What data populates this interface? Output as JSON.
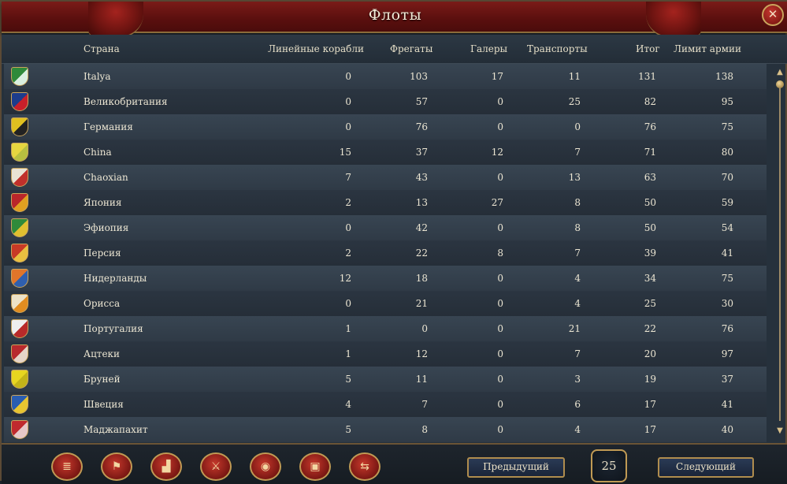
{
  "window": {
    "title": "Флоты",
    "close_icon": "close-icon"
  },
  "table": {
    "columns": [
      "Страна",
      "Линейные корабли",
      "Фрегаты",
      "Галеры",
      "Транспорты",
      "Итог",
      "Лимит армии"
    ],
    "rows": [
      {
        "country": "Italya",
        "flag": [
          "#2f8a3a",
          "#d9efe0"
        ],
        "heavy": "0",
        "frigates": "103",
        "galleys": "17",
        "transports": "11",
        "total": "131",
        "limit": "138"
      },
      {
        "country": "Великобритания",
        "flag": [
          "#1d3c8c",
          "#c8202a"
        ],
        "heavy": "0",
        "frigates": "57",
        "galleys": "0",
        "transports": "25",
        "total": "82",
        "limit": "95"
      },
      {
        "country": "Германия",
        "flag": [
          "#e0c020",
          "#222222"
        ],
        "heavy": "0",
        "frigates": "76",
        "galleys": "0",
        "transports": "0",
        "total": "76",
        "limit": "75"
      },
      {
        "country": "China",
        "flag": [
          "#e6d640",
          "#b8c040"
        ],
        "heavy": "15",
        "frigates": "37",
        "galleys": "12",
        "transports": "7",
        "total": "71",
        "limit": "80"
      },
      {
        "country": "Chaoxian",
        "flag": [
          "#e9e3d4",
          "#c0302b"
        ],
        "heavy": "7",
        "frigates": "43",
        "galleys": "0",
        "transports": "13",
        "total": "63",
        "limit": "70"
      },
      {
        "country": "Япония",
        "flag": [
          "#b9262a",
          "#e0a020"
        ],
        "heavy": "2",
        "frigates": "13",
        "galleys": "27",
        "transports": "8",
        "total": "50",
        "limit": "59"
      },
      {
        "country": "Эфиопия",
        "flag": [
          "#2f8a3a",
          "#e0c030"
        ],
        "heavy": "0",
        "frigates": "42",
        "galleys": "0",
        "transports": "8",
        "total": "50",
        "limit": "54"
      },
      {
        "country": "Персия",
        "flag": [
          "#c83a26",
          "#e9c040"
        ],
        "heavy": "2",
        "frigates": "22",
        "galleys": "8",
        "transports": "7",
        "total": "39",
        "limit": "41"
      },
      {
        "country": "Нидерланды",
        "flag": [
          "#e0752a",
          "#2f5fae"
        ],
        "heavy": "12",
        "frigates": "18",
        "galleys": "0",
        "transports": "4",
        "total": "34",
        "limit": "75"
      },
      {
        "country": "Орисса",
        "flag": [
          "#ece2c8",
          "#e08c20"
        ],
        "heavy": "0",
        "frigates": "21",
        "galleys": "0",
        "transports": "4",
        "total": "25",
        "limit": "30"
      },
      {
        "country": "Португалия",
        "flag": [
          "#eeeeee",
          "#b82a2a"
        ],
        "heavy": "1",
        "frigates": "0",
        "galleys": "0",
        "transports": "21",
        "total": "22",
        "limit": "76"
      },
      {
        "country": "Ацтеки",
        "flag": [
          "#b72a2d",
          "#e6d5c8"
        ],
        "heavy": "1",
        "frigates": "12",
        "galleys": "0",
        "transports": "7",
        "total": "20",
        "limit": "97"
      },
      {
        "country": "Бруней",
        "flag": [
          "#e8d620",
          "#c4b418"
        ],
        "heavy": "5",
        "frigates": "11",
        "galleys": "0",
        "transports": "3",
        "total": "19",
        "limit": "37"
      },
      {
        "country": "Швеция",
        "flag": [
          "#2a5db0",
          "#e8c530"
        ],
        "heavy": "4",
        "frigates": "7",
        "galleys": "0",
        "transports": "6",
        "total": "17",
        "limit": "41"
      },
      {
        "country": "Маджапахит",
        "flag": [
          "#c02a2e",
          "#e7c8c8"
        ],
        "heavy": "5",
        "frigates": "8",
        "galleys": "0",
        "transports": "4",
        "total": "17",
        "limit": "40"
      }
    ]
  },
  "footer": {
    "tabs": [
      {
        "name": "ledger-tab",
        "icon": "scroll-icon",
        "glyph": "≣"
      },
      {
        "name": "army-tab",
        "icon": "flag-icon",
        "glyph": "⚑"
      },
      {
        "name": "buildings-tab",
        "icon": "buildings-icon",
        "glyph": "▟"
      },
      {
        "name": "military-tab",
        "icon": "swords-icon",
        "glyph": "⚔"
      },
      {
        "name": "economy-tab",
        "icon": "coins-icon",
        "glyph": "◉"
      },
      {
        "name": "trade-tab",
        "icon": "crate-icon",
        "glyph": "▣"
      },
      {
        "name": "diplomacy-tab",
        "icon": "handshake-icon",
        "glyph": "⇆"
      }
    ],
    "prev_label": "Предыдущий",
    "page": "25",
    "next_label": "Следующий"
  }
}
